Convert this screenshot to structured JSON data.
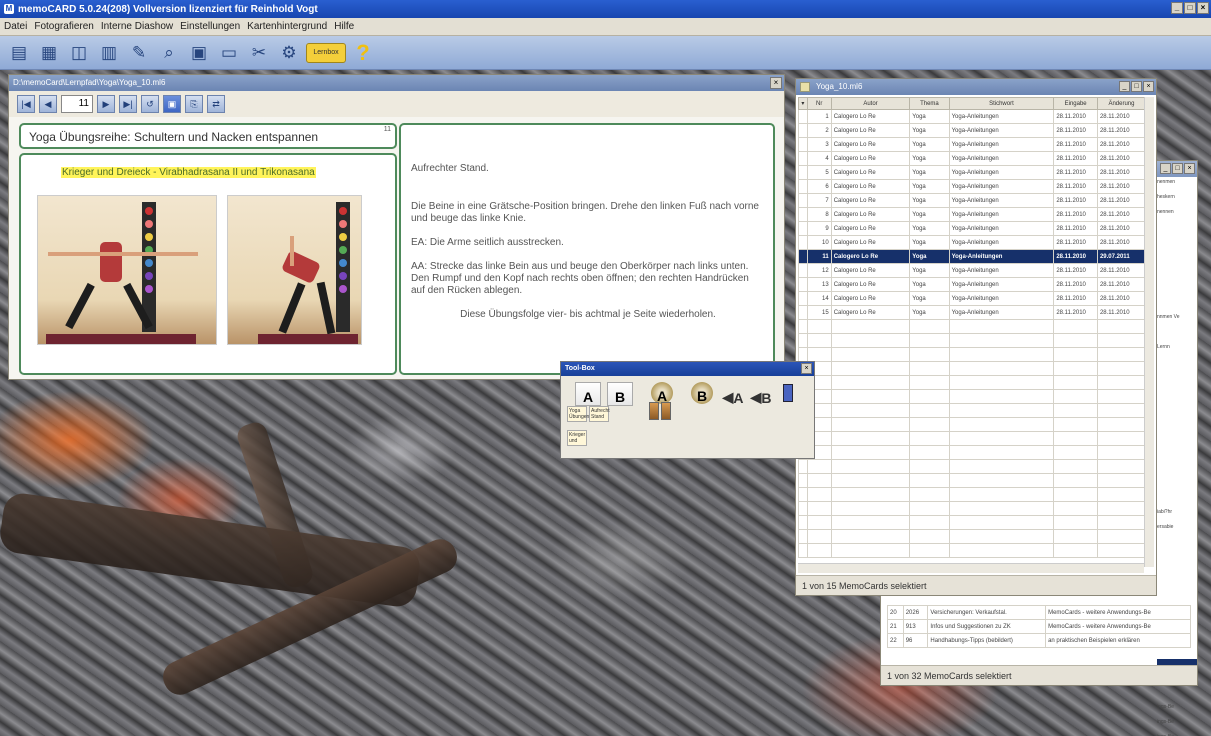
{
  "app": {
    "title": "memoCARD 5.0.24(208)  Vollversion lizenziert für Reinhold Vogt",
    "window_controls": [
      "_",
      "□",
      "×"
    ]
  },
  "menu": [
    "Datei",
    "Fotografieren",
    "Interne Diashow",
    "Einstellungen",
    "Kartenhintergrund",
    "Hilfe"
  ],
  "toolbar": {
    "icons": [
      "new-card-icon",
      "open-folder-icon",
      "layout-icon",
      "grid-icon",
      "pen-icon",
      "search-icon",
      "camera-icon",
      "monitor-icon",
      "tools-icon",
      "settings-icon"
    ],
    "note_label": "Lernbox",
    "help_label": "?"
  },
  "card_window": {
    "title": "D:\\memoCard\\Lernpfad\\Yoga\\Yoga_10.ml6",
    "page_number": "11",
    "nav_buttons": [
      "|◀",
      "◀",
      "▶",
      "▶|",
      "↺",
      "▣",
      "⎘",
      "⇄"
    ],
    "card_title": "Yoga Übungsreihe: Schultern und Nacken entspannen",
    "card_index": "11",
    "side_a_heading": "Krieger und Dreieck - Virabhadrasana II und Trikonasana",
    "side_b_paragraphs": [
      "Aufrechter Stand.",
      "Die Beine in eine Grätsche-Position bringen. Drehe den linken Fuß nach vorne und beuge das linke Knie.",
      "EA: Die Arme seitlich ausstrecken.",
      "AA: Strecke das linke Bein aus und beuge den Oberkörper nach links unten. Den Rumpf und den Kopf nach rechts oben öffnen; den rechten Handrücken auf den Rücken ablegen.",
      "Diese Übungsfolge vier- bis achtmal je Seite wiederholen."
    ]
  },
  "list_window": {
    "title": "Yoga_10.ml6",
    "columns": [
      "Nr",
      "Autor",
      "Thema",
      "Stichwort",
      "Eingabe",
      "Änderung"
    ],
    "rows": [
      [
        "1",
        "Calogero Lo Re",
        "Yoga",
        "Yoga-Anleitungen",
        "28.11.2010",
        "28.11.2010"
      ],
      [
        "2",
        "Calogero Lo Re",
        "Yoga",
        "Yoga-Anleitungen",
        "28.11.2010",
        "28.11.2010"
      ],
      [
        "3",
        "Calogero Lo Re",
        "Yoga",
        "Yoga-Anleitungen",
        "28.11.2010",
        "28.11.2010"
      ],
      [
        "4",
        "Calogero Lo Re",
        "Yoga",
        "Yoga-Anleitungen",
        "28.11.2010",
        "28.11.2010"
      ],
      [
        "5",
        "Calogero Lo Re",
        "Yoga",
        "Yoga-Anleitungen",
        "28.11.2010",
        "28.11.2010"
      ],
      [
        "6",
        "Calogero Lo Re",
        "Yoga",
        "Yoga-Anleitungen",
        "28.11.2010",
        "28.11.2010"
      ],
      [
        "7",
        "Calogero Lo Re",
        "Yoga",
        "Yoga-Anleitungen",
        "28.11.2010",
        "28.11.2010"
      ],
      [
        "8",
        "Calogero Lo Re",
        "Yoga",
        "Yoga-Anleitungen",
        "28.11.2010",
        "28.11.2010"
      ],
      [
        "9",
        "Calogero Lo Re",
        "Yoga",
        "Yoga-Anleitungen",
        "28.11.2010",
        "28.11.2010"
      ],
      [
        "10",
        "Calogero Lo Re",
        "Yoga",
        "Yoga-Anleitungen",
        "28.11.2010",
        "28.11.2010"
      ],
      [
        "11",
        "Calogero Lo Re",
        "Yoga",
        "Yoga-Anleitungen",
        "28.11.2010",
        "29.07.2011"
      ],
      [
        "12",
        "Calogero Lo Re",
        "Yoga",
        "Yoga-Anleitungen",
        "28.11.2010",
        "28.11.2010"
      ],
      [
        "13",
        "Calogero Lo Re",
        "Yoga",
        "Yoga-Anleitungen",
        "28.11.2010",
        "28.11.2010"
      ],
      [
        "14",
        "Calogero Lo Re",
        "Yoga",
        "Yoga-Anleitungen",
        "28.11.2010",
        "28.11.2010"
      ],
      [
        "15",
        "Calogero Lo Re",
        "Yoga",
        "Yoga-Anleitungen",
        "28.11.2010",
        "28.11.2010"
      ]
    ],
    "selected_row": 11,
    "status": "1 von 15 MemoCards selektiert"
  },
  "back_window": {
    "edge_texts": [
      "nenmen",
      "heskern",
      "nennen",
      "",
      "",
      "",
      "",
      "",
      "",
      "nnmen Ve",
      "",
      "Lernn",
      "",
      "",
      "",
      "",
      "",
      "",
      "",
      "",
      "",
      "",
      "iabi?hr",
      "ersabie",
      "",
      "",
      "",
      "",
      "",
      "",
      "",
      "",
      "",
      "",
      "",
      "ings-Be",
      "ings-Be",
      "ings-Be",
      "ings-Be"
    ],
    "edge_selected_index": 32,
    "rows": [
      [
        "20",
        "2026",
        "Versicherungen: Verkaufstal.",
        "MemoCards - weitere Anwendungs-Be"
      ],
      [
        "21",
        "913",
        "Infos und Suggestionen zu ZK",
        "MemoCards - weitere Anwendungs-Be"
      ],
      [
        "22",
        "96",
        "Handhabungs-Tipps (bebildert)",
        "an praktischen Beispielen erklären"
      ]
    ],
    "status": "1 von 32 MemoCards selektiert"
  },
  "toolbox": {
    "title": "Tool-Box",
    "tools": [
      "A",
      "B",
      "A",
      "B",
      "A",
      "B"
    ],
    "labels": [
      "Yoga Übungen",
      "Aufrecht Stand",
      "Krieger und"
    ]
  }
}
